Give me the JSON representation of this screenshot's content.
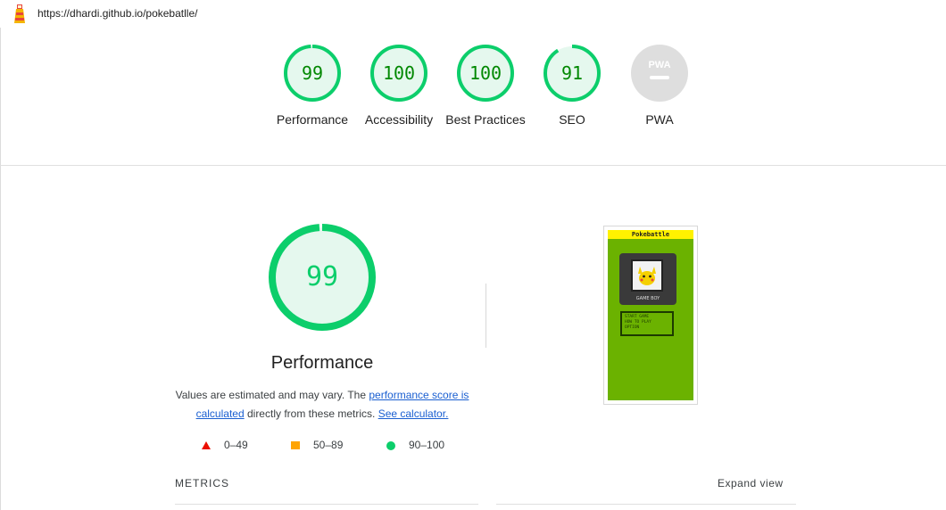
{
  "header": {
    "url": "https://dhardi.github.io/pokebatlle/",
    "logo_icon": "lighthouse-icon"
  },
  "colors": {
    "pass": "#0cce6b",
    "pass_text": "#008800",
    "pass_bg": "#e5f8ee",
    "average": "#ffa400",
    "fail": "#eb0f00",
    "na": "#c0c0c0"
  },
  "categories": [
    {
      "id": "performance",
      "score": "99",
      "score_value": 99,
      "label": "Performance"
    },
    {
      "id": "accessibility",
      "score": "100",
      "score_value": 100,
      "label": "Accessibility"
    },
    {
      "id": "best-practices",
      "score": "100",
      "score_value": 100,
      "label": "Best Practices"
    },
    {
      "id": "seo",
      "score": "91",
      "score_value": 91,
      "label": "SEO"
    },
    {
      "id": "pwa",
      "score": "PWA",
      "score_value": null,
      "label": "PWA"
    }
  ],
  "performance": {
    "score": "99",
    "score_value": 99,
    "title": "Performance",
    "desc_part1": "Values are estimated and may vary. The ",
    "desc_link1": "performance score is calculated",
    "desc_part2": " directly from these metrics. ",
    "desc_link2": "See calculator."
  },
  "legend": {
    "fail": "0–49",
    "average": "50–89",
    "pass": "90–100"
  },
  "screenshot": {
    "banner": "Pokebattle",
    "console": "GAME BOY",
    "menu": [
      "START GAME",
      "HOW TO PLAY",
      "OPTION"
    ]
  },
  "metrics": {
    "label": "METRICS",
    "expand": "Expand view"
  }
}
